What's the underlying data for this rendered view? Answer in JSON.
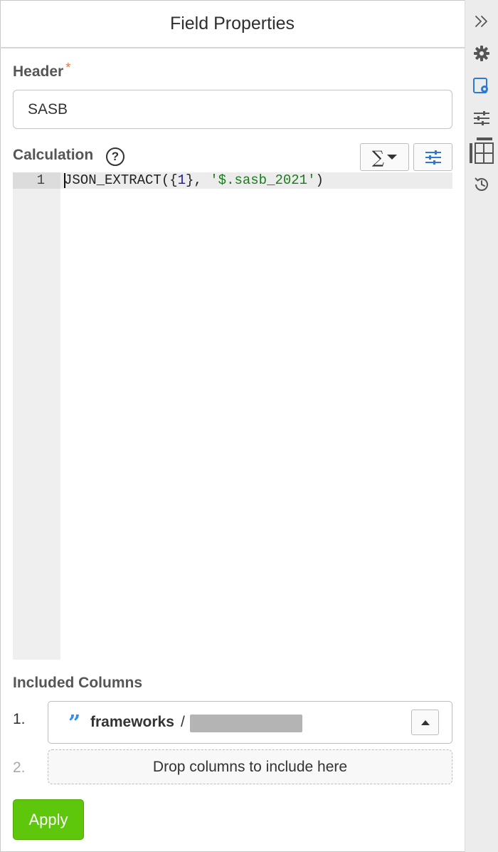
{
  "panel": {
    "title": "Field Properties"
  },
  "header_field": {
    "label": "Header",
    "required_mark": "*",
    "value": "SASB"
  },
  "calculation": {
    "label": "Calculation",
    "help_glyph": "?",
    "function_button_glyph": "∑",
    "line_number": "1",
    "code": {
      "fn": "JSON_EXTRACT(",
      "open_brace": "{",
      "arg_num": "1",
      "close_brace": "}",
      "comma": ", ",
      "arg_str": "'$.sasb_2021'",
      "close_paren": ")"
    }
  },
  "included_columns": {
    "label": "Included Columns",
    "items": [
      {
        "index": "1.",
        "icon": "quote-icon",
        "name": "frameworks",
        "separator": "/"
      }
    ],
    "next_index": "2.",
    "dropzone_text": "Drop columns to include here"
  },
  "actions": {
    "apply_label": "Apply"
  },
  "toolbar": {
    "items": [
      "collapse-icon",
      "gear-icon",
      "field-settings-icon",
      "sliders-icon",
      "table-layout-icon",
      "history-icon"
    ],
    "active": "field-settings-icon",
    "active_color": "#2d7ad6"
  },
  "colors": {
    "apply_green": "#5fc70b",
    "required_orange": "#e8743b",
    "code_number": "#1a1aa6",
    "code_string": "#1d7a1d"
  }
}
